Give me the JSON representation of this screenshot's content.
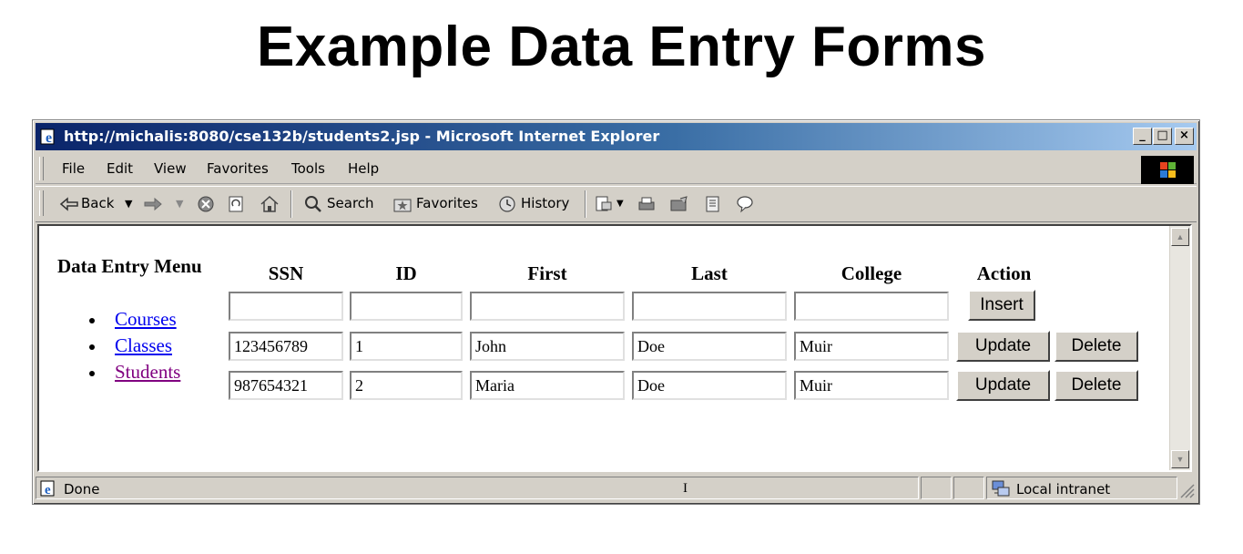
{
  "slide": {
    "title": "Example Data Entry Forms"
  },
  "window": {
    "title": "http://michalis:8080/cse132b/students2.jsp - Microsoft Internet Explorer",
    "controls": {
      "minimize": "_",
      "maximize": "□",
      "close": "×"
    }
  },
  "menubar": {
    "items": [
      "File",
      "Edit",
      "View",
      "Favorites",
      "Tools",
      "Help"
    ]
  },
  "toolbar": {
    "back": "Back",
    "search": "Search",
    "favorites": "Favorites",
    "history": "History"
  },
  "nav": {
    "title": "Data Entry Menu",
    "links": [
      "Courses",
      "Classes",
      "Students"
    ]
  },
  "table": {
    "headers": [
      "SSN",
      "ID",
      "First",
      "Last",
      "College",
      "Action"
    ],
    "insert_label": "Insert",
    "update_label": "Update",
    "delete_label": "Delete",
    "rows": [
      {
        "ssn": "123456789",
        "id": "1",
        "first": "John",
        "last": "Doe",
        "college": "Muir"
      },
      {
        "ssn": "987654321",
        "id": "2",
        "first": "Maria",
        "last": "Doe",
        "college": "Muir"
      }
    ]
  },
  "status": {
    "text": "Done",
    "zone": "Local intranet"
  }
}
